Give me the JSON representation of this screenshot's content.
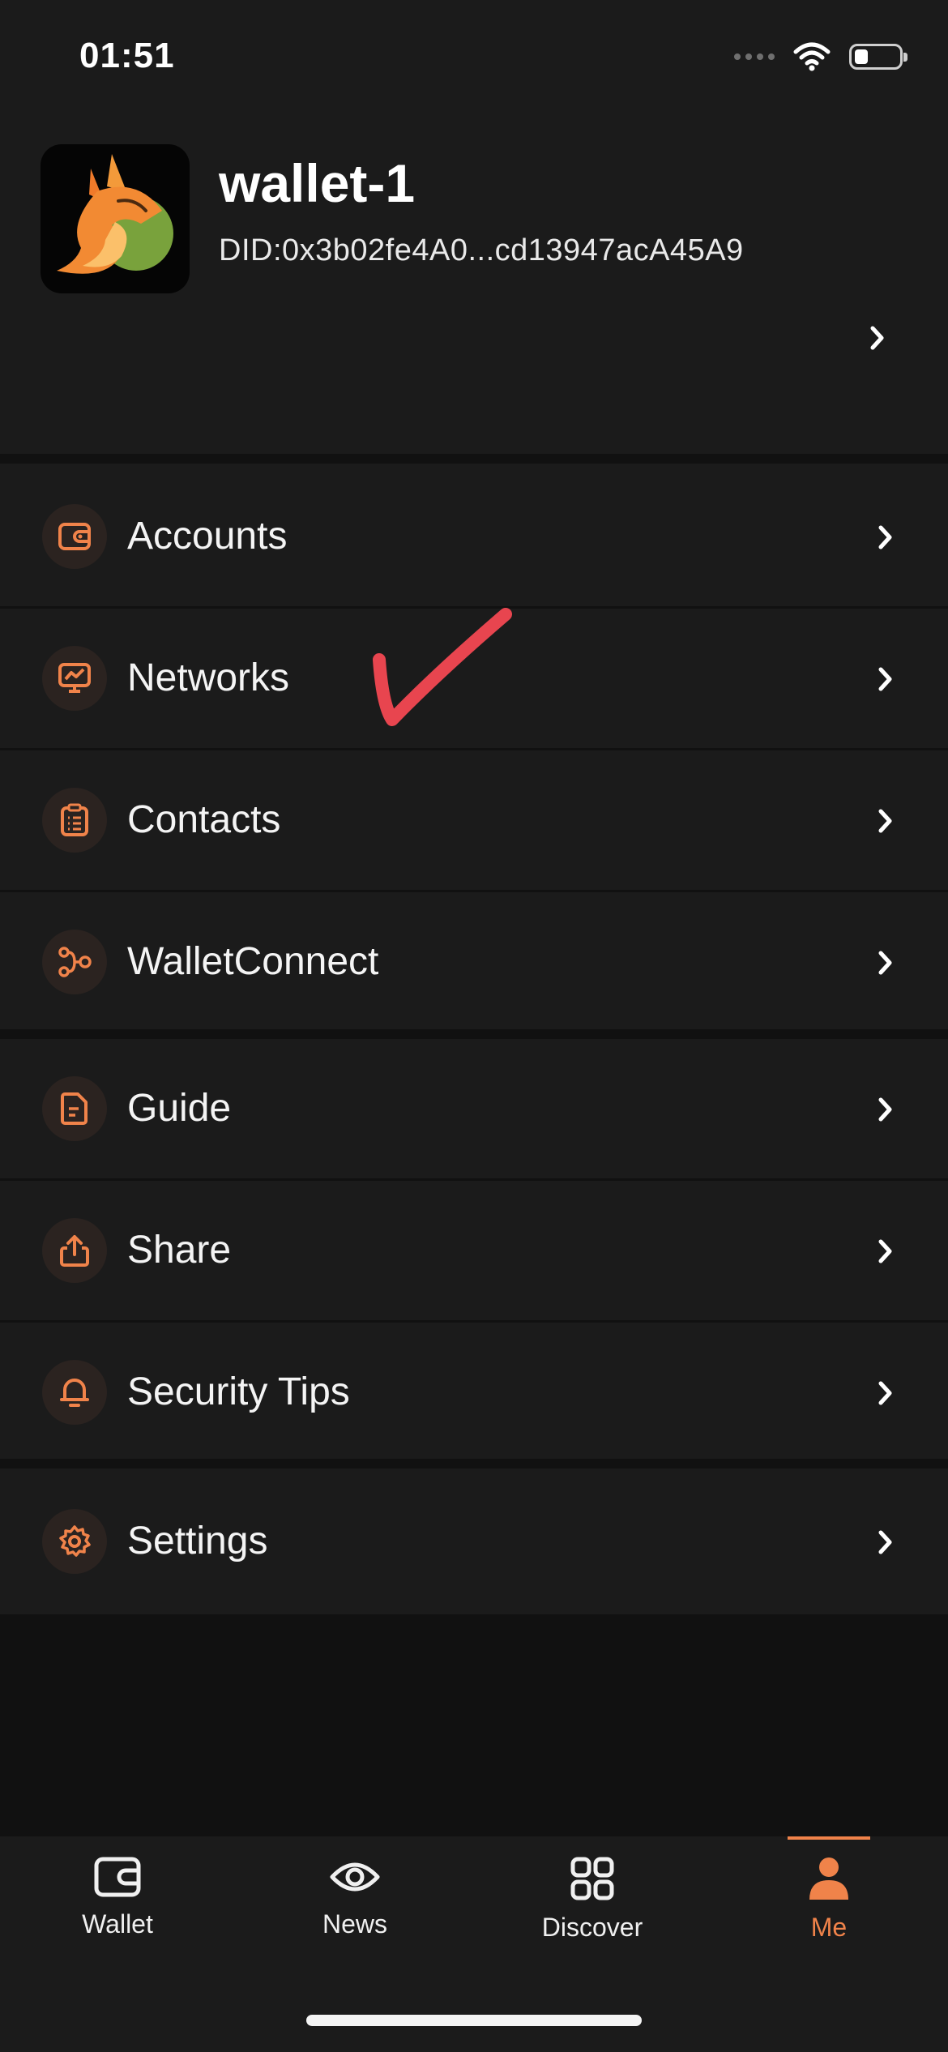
{
  "status_bar": {
    "time": "01:51"
  },
  "profile": {
    "name": "wallet-1",
    "did": "DID:0x3b02fe4A0...cd13947acA45A9"
  },
  "menu": {
    "accounts": "Accounts",
    "networks": "Networks",
    "contacts": "Contacts",
    "walletconnect": "WalletConnect",
    "guide": "Guide",
    "share": "Share",
    "security_tips": "Security Tips",
    "settings": "Settings"
  },
  "tabs": {
    "wallet": "Wallet",
    "news": "News",
    "discover": "Discover",
    "me": "Me",
    "active": "Me"
  },
  "colors": {
    "accent": "#f0834a",
    "background": "#111111",
    "surface": "#1b1b1b",
    "annotation": "#e8454f"
  },
  "icons": [
    "wallet-icon",
    "network-chart-icon",
    "contacts-list-icon",
    "walletconnect-nodes-icon",
    "guide-document-icon",
    "share-upload-icon",
    "bell-icon",
    "gear-icon",
    "eye-icon",
    "grid-icon",
    "person-icon",
    "chevron-right-icon",
    "wifi-icon",
    "battery-icon"
  ]
}
